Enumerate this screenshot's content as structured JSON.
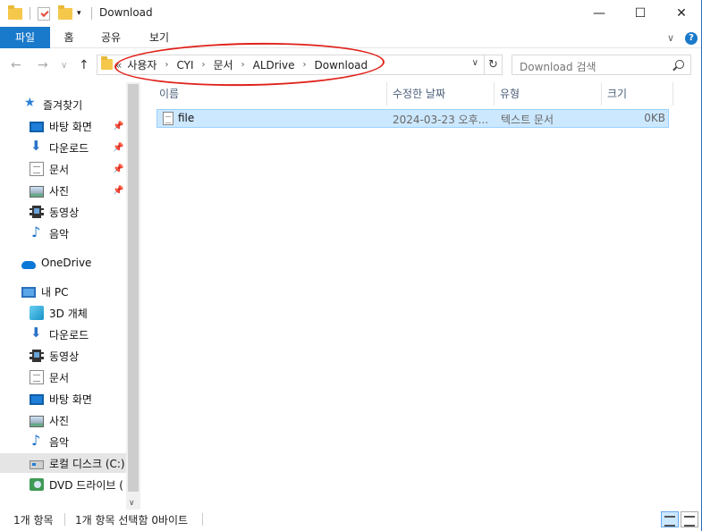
{
  "window": {
    "title": "Download",
    "minimize_glyph": "—",
    "maximize_glyph": "☐",
    "close_glyph": "✕"
  },
  "ribbon": {
    "tabs": [
      {
        "label": "파일"
      },
      {
        "label": "홈"
      },
      {
        "label": "공유"
      },
      {
        "label": "보기"
      }
    ],
    "collapse_glyph": "∨",
    "help_glyph": "?"
  },
  "nav": {
    "back_glyph": "←",
    "forward_glyph": "→",
    "recent_glyph": "∨",
    "up_glyph": "↑",
    "overflow_glyph": "«",
    "crumbs": [
      "사용자",
      "CYI",
      "문서",
      "ALDrive",
      "Download"
    ],
    "crumb_sep": "›",
    "dropdown_glyph": "∨",
    "refresh_glyph": "↻"
  },
  "search": {
    "placeholder": "Download 검색"
  },
  "sidebar": {
    "quick_access": "즐겨찾기",
    "quick_items": [
      "바탕 화면",
      "다운로드",
      "문서",
      "사진",
      "동영상",
      "음악"
    ],
    "pin_glyph": "📌",
    "onedrive": "OneDrive",
    "this_pc": "내 PC",
    "pc_items": [
      "3D 개체",
      "다운로드",
      "동영상",
      "문서",
      "바탕 화면",
      "사진",
      "음악",
      "로컬 디스크 (C:)",
      "DVD 드라이브 ("
    ],
    "scroll_down_glyph": "∨"
  },
  "columns": {
    "name": "이름",
    "modified": "수정한 날짜",
    "type": "유형",
    "size": "크기"
  },
  "files": [
    {
      "name": "file",
      "modified": "2024-03-23 오후...",
      "type": "텍스트 문서",
      "size": "0KB"
    }
  ],
  "status": {
    "count": "1개 항목",
    "selected": "1개 항목 선택함 0바이트"
  },
  "colors": {
    "accent": "#1979ca",
    "selection": "#cce8ff",
    "annotation": "#e0211a"
  }
}
